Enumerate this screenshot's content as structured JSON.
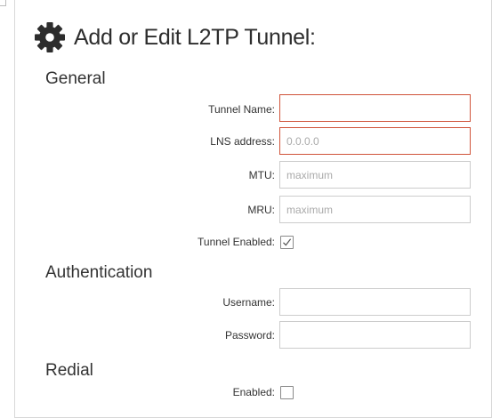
{
  "dialog": {
    "title": "Add or Edit L2TP Tunnel:",
    "title_icon": "gear-icon"
  },
  "general": {
    "heading": "General",
    "tunnel_name": {
      "label": "Tunnel Name:",
      "value": "",
      "placeholder": "",
      "state": "invalid"
    },
    "lns_address": {
      "label": "LNS address:",
      "value": "",
      "placeholder": "0.0.0.0",
      "state": "invalid"
    },
    "mtu": {
      "label": "MTU:",
      "value": "",
      "placeholder": "maximum"
    },
    "mru": {
      "label": "MRU:",
      "value": "",
      "placeholder": "maximum"
    },
    "tunnel_enabled": {
      "label": "Tunnel Enabled:",
      "checked": true
    }
  },
  "authentication": {
    "heading": "Authentication",
    "username": {
      "label": "Username:",
      "value": "",
      "placeholder": ""
    },
    "password": {
      "label": "Password:",
      "value": "",
      "placeholder": ""
    }
  },
  "redial": {
    "heading": "Redial",
    "enabled": {
      "label": "Enabled:",
      "checked": false
    }
  },
  "colors": {
    "invalid_border": "#d0533a",
    "field_border": "#cccccc",
    "text": "#333333"
  }
}
